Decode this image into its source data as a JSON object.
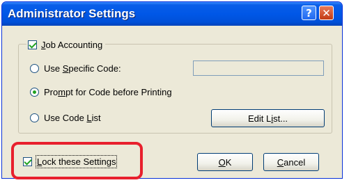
{
  "window": {
    "title": "Administrator Settings"
  },
  "titlebar": {
    "help_glyph": "?",
    "close_glyph": "✕"
  },
  "group": {
    "checkbox_label": "Job Accounting",
    "checked": true
  },
  "options": [
    {
      "label_pre": "Use ",
      "accel": "S",
      "label_post": "pecific Code:",
      "selected": false
    },
    {
      "label_pre": "Pro",
      "accel": "m",
      "label_post": "pt for Code before Printing",
      "selected": true
    },
    {
      "label_pre": "Use Code ",
      "accel": "L",
      "label_post": "ist",
      "selected": false
    }
  ],
  "specific_code_value": "",
  "buttons": {
    "edit_pre": "Edit L",
    "edit_accel": "i",
    "edit_post": "st...",
    "ok_accel": "O",
    "ok_post": "K",
    "cancel_pre": "",
    "cancel_accel": "C",
    "cancel_post": "ancel"
  },
  "lock": {
    "label": "Lock these Settings",
    "checked": true,
    "highlight_color": "#e8202d"
  }
}
